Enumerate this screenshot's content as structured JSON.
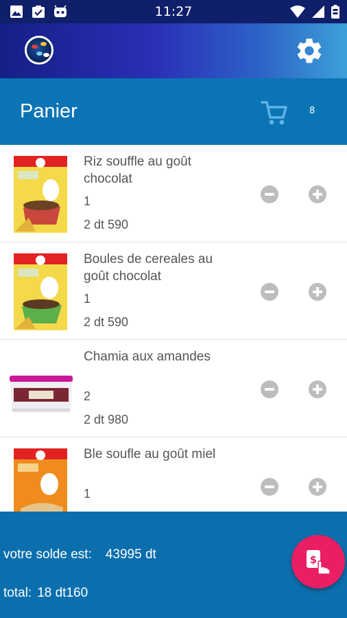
{
  "status_bar": {
    "time": "11:27",
    "left_icons": [
      "image-icon",
      "checklist-icon",
      "android-icon"
    ],
    "right_icons": [
      "wifi-icon",
      "signal-icon",
      "battery-icon"
    ]
  },
  "app_bar": {
    "logo": "app-logo",
    "settings_icon": "gear-icon"
  },
  "cart_header": {
    "title": "Panier",
    "cart_icon": "shopping-cart-icon",
    "count": "8"
  },
  "items": [
    {
      "name": "Riz souffle au goût chocolat",
      "quantity": "1",
      "price": "2 dt 590"
    },
    {
      "name": "Boules de cereales au goût chocolat",
      "quantity": "1",
      "price": "2 dt 590"
    },
    {
      "name": "Chamia aux amandes",
      "quantity": "2",
      "price": "2 dt 980"
    },
    {
      "name": "Ble soufle au goût miel",
      "quantity": "1",
      "price": ""
    }
  ],
  "footer": {
    "balance_label": "votre solde est:",
    "balance_value": "43995 dt",
    "total_label": "total:",
    "total_value": "18 dt160"
  },
  "fab": {
    "icon": "pay-hand-icon"
  },
  "colors": {
    "status_bar": "#0f1f6a",
    "app_bar_start": "#161f86",
    "app_bar_end": "#3ca0d8",
    "cart_header": "#0b74b5",
    "footer": "#0b6fae",
    "fab": "#e91e63",
    "stepper_button": "#bdbdbd",
    "item_text": "#555555"
  }
}
